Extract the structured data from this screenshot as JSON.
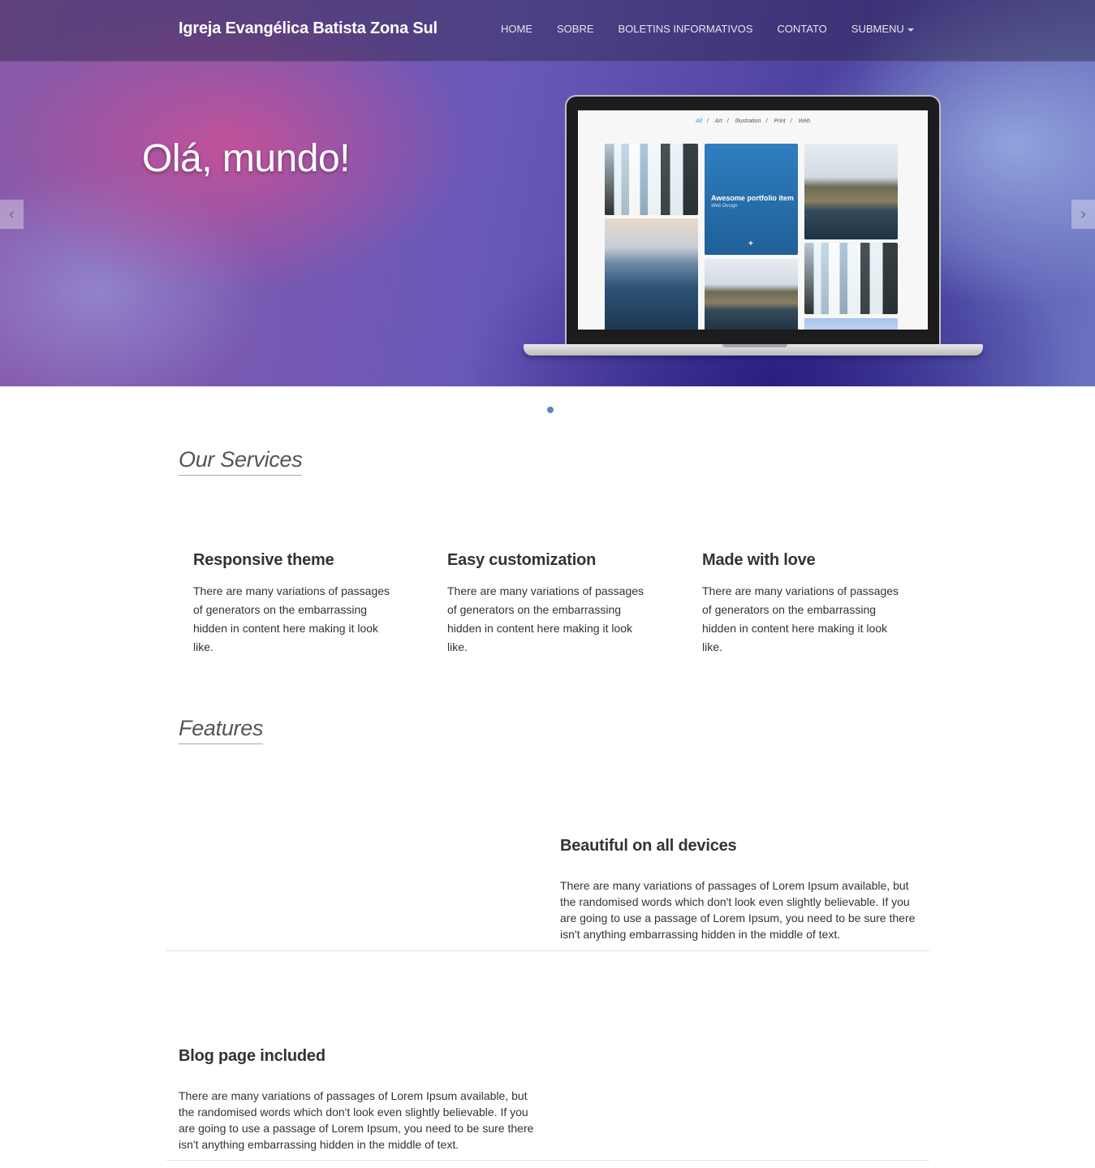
{
  "navbar": {
    "brand": "Igreja Evangélica Batista Zona Sul",
    "items": [
      "HOME",
      "SOBRE",
      "BOLETINS INFORMATIVOS",
      "CONTATO",
      "SUBMENU"
    ]
  },
  "hero": {
    "title": "Olá, mundo!",
    "prev_icon": "chevron-left-icon",
    "next_icon": "chevron-right-icon",
    "slides_count": 1,
    "active_slide": 1
  },
  "laptop_screen": {
    "filters": [
      "All",
      "Art",
      "Illustration",
      "Print",
      "Web"
    ],
    "active_filter": "All",
    "portfolio_item_title": "Awesome portfolio item",
    "portfolio_item_subtitle": "Web Design",
    "portfolio_item_icon": "+"
  },
  "services": {
    "heading": "Our Services",
    "items": [
      {
        "title": "Responsive theme",
        "text": "There are many variations of passages of generators on the embarrassing hidden in content here making it look like."
      },
      {
        "title": "Easy customization",
        "text": "There are many variations of passages of generators on the embarrassing hidden in content here making it look like."
      },
      {
        "title": "Made with love",
        "text": "There are many variations of passages of generators on the embarrassing hidden in content here making it look like."
      }
    ]
  },
  "features": {
    "heading": "Features",
    "items": [
      {
        "title": "Beautiful on all devices",
        "text": "There are many variations of passages of Lorem Ipsum available, but the randomised words which don't look even slightly believable. If you are going to use a passage of Lorem Ipsum, you need to be sure there isn't anything embarrassing hidden in the middle of text."
      },
      {
        "title": "Blog page included",
        "text": "There are many variations of passages of Lorem Ipsum available, but the randomised words which don't look even slightly believable. If you are going to use a passage of Lorem Ipsum, you need to be sure there isn't anything embarrassing hidden in the middle of text."
      }
    ]
  },
  "colors": {
    "accent": "#5a84c4",
    "filter_active": "#3a8fd6"
  }
}
